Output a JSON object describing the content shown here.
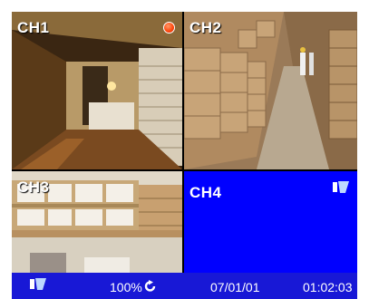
{
  "channels": [
    {
      "label": "CH1",
      "recording": true
    },
    {
      "label": "CH2"
    },
    {
      "label": "CH3"
    },
    {
      "label": "CH4",
      "signal": "no-video",
      "background": "#0000ff"
    }
  ],
  "status_bar": {
    "zoom": "100%",
    "date": "07/01/01",
    "time": "01:02:03",
    "background": "#1818d6"
  },
  "icons": {
    "camera": "camera-icon",
    "record": "record-indicator-icon",
    "refresh": "refresh-icon"
  }
}
